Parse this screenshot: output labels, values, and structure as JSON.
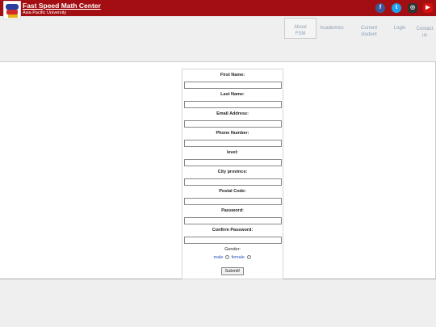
{
  "header": {
    "title": "Fast Speed Math Center",
    "subtitle": "Asia Pacific University",
    "social": [
      "facebook-icon",
      "twitter-icon",
      "instagram-icon",
      "youtube-icon"
    ]
  },
  "nav": {
    "about_line1": "About",
    "about_line2": "FSM",
    "academics": "Academics",
    "current_line1": "Current",
    "current_line2": "student",
    "login": "Login",
    "contact_line1": "Contact",
    "contact_line2": "us"
  },
  "form": {
    "first_name": "First Name:",
    "last_name": "Last Name:",
    "email": "Email Address:",
    "phone": "Phone Number:",
    "level": "level:",
    "city": "City province:",
    "postal": "Postal Code:",
    "password": "Password:",
    "confirm_password": "Confirm Password:",
    "gender": "Gender:",
    "male": "male",
    "female": "female",
    "submit": "Submit!"
  },
  "colors": {
    "header_bg": "#a20e12",
    "link": "#2a52c4"
  }
}
